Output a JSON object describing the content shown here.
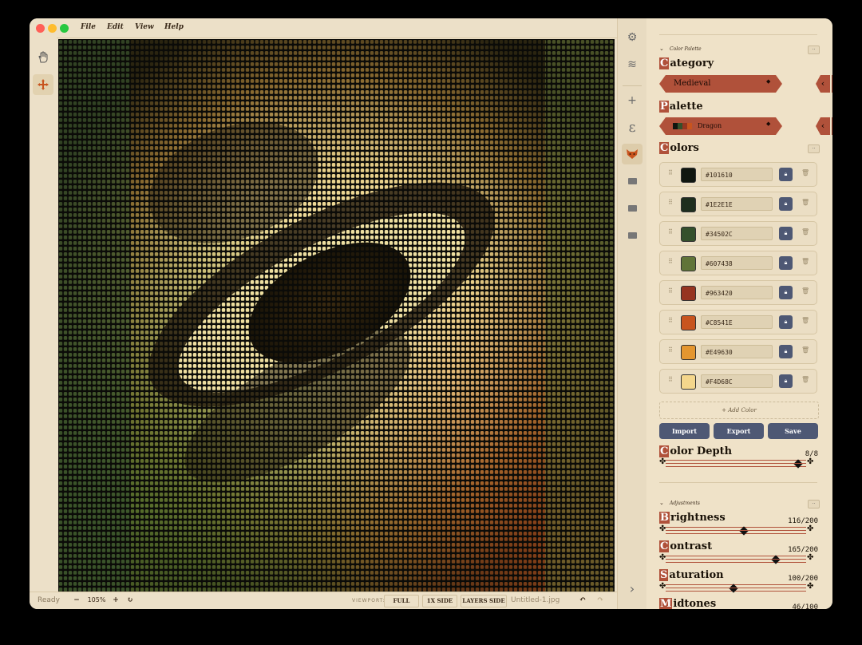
{
  "menubar": {
    "items": [
      "File",
      "Edit",
      "View",
      "Help"
    ]
  },
  "statusbar": {
    "status": "Ready",
    "zoom_minus": "−",
    "zoom": "105%",
    "zoom_plus": "+",
    "reset": "↻",
    "viewport_label": "VIEWPORT:",
    "viewport_buttons": [
      "FULL",
      "1X SIDE",
      "LAYERS SIDE"
    ],
    "filename": "Untitled-1.jpg",
    "undo": "↶",
    "redo": "↷"
  },
  "toolstrip": {
    "icons": [
      "hand-icon",
      "move-icon"
    ]
  },
  "iconbar": {
    "icons": [
      "gear-icon",
      "layers-icon",
      "plus-icon",
      "font-icon",
      "dragon-mask-icon",
      "box-icon",
      "box-icon",
      "box-icon",
      "chevron-right-icon"
    ]
  },
  "palette_panel": {
    "section_title": "Color Palette",
    "category_label_first": "C",
    "category_label_rest": "ategory",
    "category_value": "Medieval",
    "palette_label_first": "P",
    "palette_label_rest": "alette",
    "palette_value": "Dragon",
    "colors_label_first": "C",
    "colors_label_rest": "olors",
    "colors": [
      "#101610",
      "#1E2E1E",
      "#34502C",
      "#607438",
      "#963420",
      "#C8541E",
      "#E49630",
      "#F4D68C"
    ],
    "add_color": "+ Add Color",
    "buttons": [
      "Import",
      "Export",
      "Save"
    ],
    "color_depth_label_first": "C",
    "color_depth_label_rest": "olor Depth",
    "color_depth_value": "8/8",
    "color_depth_fraction": 1.0
  },
  "adjustments": {
    "section_title": "Adjustments",
    "items": [
      {
        "first": "B",
        "rest": "rightness",
        "value": "116/200",
        "fraction": 0.58
      },
      {
        "first": "C",
        "rest": "ontrast",
        "value": "165/200",
        "fraction": 0.825
      },
      {
        "first": "S",
        "rest": "aturation",
        "value": "100/200",
        "fraction": 0.5
      },
      {
        "first": "M",
        "rest": "idtones",
        "value": "46/100",
        "fraction": 0.46
      }
    ]
  },
  "colors": {
    "accent": "#b0513a",
    "button": "#4e5874",
    "background": "#ece0c8"
  }
}
